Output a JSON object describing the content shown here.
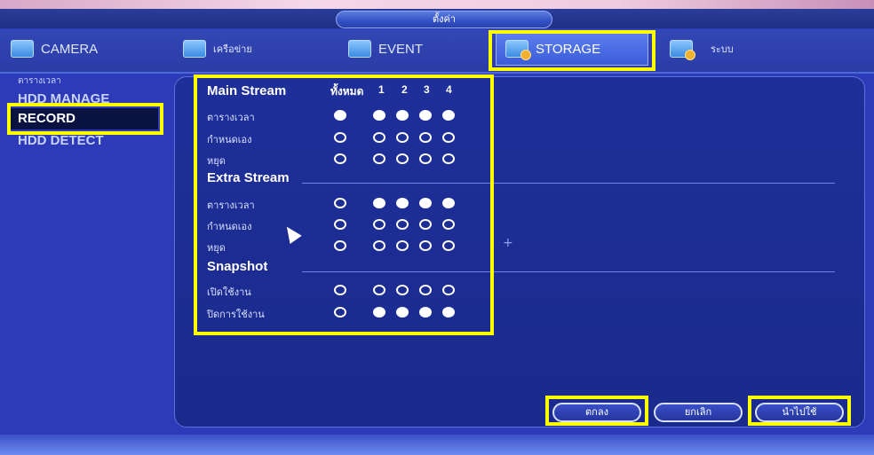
{
  "window": {
    "title": "ตั้งค่า"
  },
  "tabs": [
    {
      "label": "CAMERA",
      "icon": "camera-icon"
    },
    {
      "label": "เครือข่าย",
      "icon": "network-icon"
    },
    {
      "label": "EVENT",
      "icon": "event-icon"
    },
    {
      "label": "STORAGE",
      "icon": "storage-icon",
      "active": true
    },
    {
      "label": "ระบบ",
      "icon": "system-icon"
    }
  ],
  "sidebar": {
    "items": [
      {
        "label": "ตารางเวลา"
      },
      {
        "label": "HDD MANAGE"
      },
      {
        "label": "RECORD",
        "active": true
      },
      {
        "label": "HDD DETECT"
      }
    ]
  },
  "record": {
    "header": {
      "all": "ทั้งหมด",
      "channels": [
        "1",
        "2",
        "3",
        "4"
      ]
    },
    "sections": [
      {
        "title": "Main Stream",
        "rows": [
          {
            "label": "ตารางเวลา",
            "all": true,
            "ch": [
              true,
              true,
              true,
              true
            ]
          },
          {
            "label": "กำหนดเอง",
            "all": false,
            "ch": [
              false,
              false,
              false,
              false
            ]
          },
          {
            "label": "หยุด",
            "all": false,
            "ch": [
              false,
              false,
              false,
              false
            ]
          }
        ]
      },
      {
        "title": "Extra Stream",
        "rows": [
          {
            "label": "ตารางเวลา",
            "all": false,
            "ch": [
              true,
              true,
              true,
              true
            ]
          },
          {
            "label": "กำหนดเอง",
            "all": false,
            "ch": [
              false,
              false,
              false,
              false
            ]
          },
          {
            "label": "หยุด",
            "all": false,
            "ch": [
              false,
              false,
              false,
              false
            ]
          }
        ]
      },
      {
        "title": "Snapshot",
        "rows": [
          {
            "label": "เปิดใช้งาน",
            "all": false,
            "ch": [
              false,
              false,
              false,
              false
            ]
          },
          {
            "label": "ปิดการใช้งาน",
            "all": false,
            "ch": [
              true,
              true,
              true,
              true
            ]
          }
        ]
      }
    ]
  },
  "buttons": {
    "ok": "ตกลง",
    "cancel": "ยกเลิก",
    "apply": "นำไปใช้"
  },
  "colors": {
    "highlight": "#ffff00",
    "background": "#2d3bb8",
    "panel": "#1e2f9a"
  }
}
